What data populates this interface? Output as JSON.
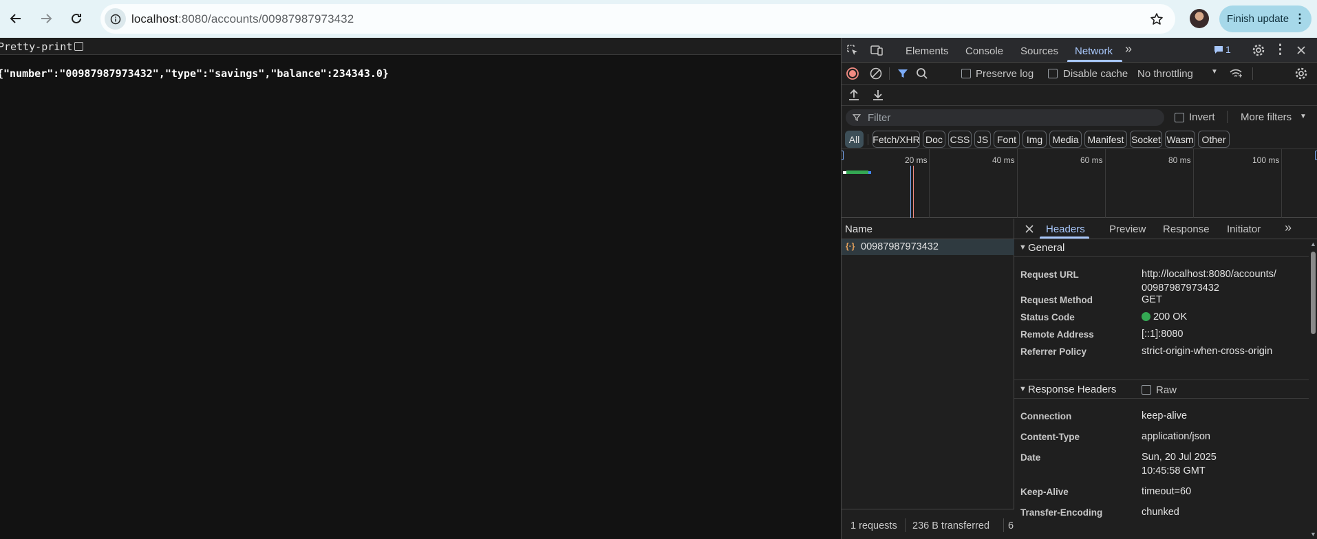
{
  "browser": {
    "url_host": "localhost",
    "url_path": ":8080/accounts/00987987973432",
    "finish_update_label": "Finish update"
  },
  "page": {
    "pretty_print_label": "Pretty-print",
    "json_text": "{\"number\":\"00987987973432\",\"type\":\"savings\",\"balance\":234343.0}"
  },
  "devtools": {
    "tabs": [
      "Elements",
      "Console",
      "Sources",
      "Network"
    ],
    "active_tab": "Network",
    "issues_count": "1",
    "toolbar": {
      "preserve_log": "Preserve log",
      "disable_cache": "Disable cache",
      "throttling": "No throttling"
    },
    "filter": {
      "placeholder": "Filter",
      "invert": "Invert",
      "more_filters": "More filters"
    },
    "type_filters": [
      "All",
      "Fetch/XHR",
      "Doc",
      "CSS",
      "JS",
      "Font",
      "Img",
      "Media",
      "Manifest",
      "Socket",
      "Wasm",
      "Other"
    ],
    "timeline_labels": [
      "20 ms",
      "40 ms",
      "60 ms",
      "80 ms",
      "100 ms"
    ],
    "name_header": "Name",
    "request_name": "00987987973432",
    "status_bar": {
      "requests": "1 requests",
      "transferred": "236 B transferred",
      "more": "6"
    },
    "detail_tabs": [
      "Headers",
      "Preview",
      "Response",
      "Initiator"
    ],
    "general": {
      "title": "General",
      "request_url_key": "Request URL",
      "request_url": "http://localhost:8080/accounts/00987987973432",
      "request_method_key": "Request Method",
      "request_method": "GET",
      "status_code_key": "Status Code",
      "status_code": "200 OK",
      "remote_address_key": "Remote Address",
      "remote_address": "[::1]:8080",
      "referrer_policy_key": "Referrer Policy",
      "referrer_policy": "strict-origin-when-cross-origin"
    },
    "response_headers": {
      "title": "Response Headers",
      "raw_label": "Raw",
      "connection_key": "Connection",
      "connection": "keep-alive",
      "content_type_key": "Content-Type",
      "content_type": "application/json",
      "date_key": "Date",
      "date": "Sun, 20 Jul 2025 10:45:58 GMT",
      "keep_alive_key": "Keep-Alive",
      "keep_alive": "timeout=60",
      "transfer_encoding_key": "Transfer-Encoding",
      "transfer_encoding": "chunked"
    },
    "colors": {
      "accent": "#a8c7fa",
      "record_red": "#f28b82",
      "status_green": "#34a853"
    }
  }
}
